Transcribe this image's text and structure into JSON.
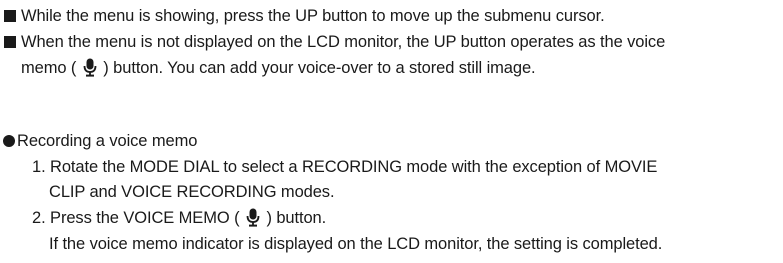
{
  "bullets": {
    "item1": "While the menu is showing, press the UP button to move up the submenu cursor.",
    "item2_line1": "When the menu is not displayed on the LCD monitor, the UP button operates as the voice",
    "item2_line2_pre": "memo (",
    "item2_line2_post": ")  button. You can add your voice-over to a stored still image."
  },
  "section": {
    "heading": "Recording a voice memo",
    "step1_line1": "1. Rotate the MODE DIAL to select a RECORDING mode with the exception of  MOVIE",
    "step1_line2": "CLIP and  VOICE RECORDING modes.",
    "step2_line1_pre": "2. Press the VOICE MEMO (",
    "step2_line1_post": ") button.",
    "step2_line2": "If the voice memo indicator is displayed on the LCD monitor, the setting is completed."
  },
  "icons": {
    "bullet_square": "square-bullet-icon",
    "bullet_circle": "circle-bullet-icon",
    "voice_memo": "microphone-icon"
  }
}
